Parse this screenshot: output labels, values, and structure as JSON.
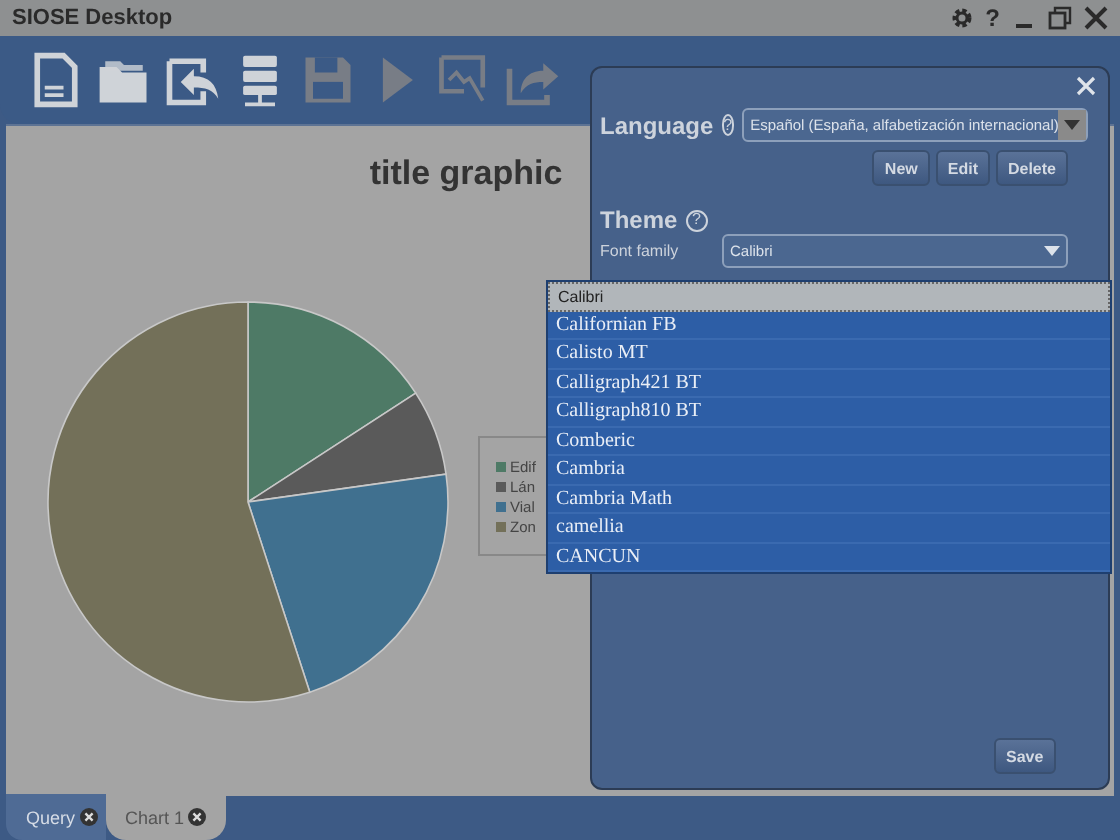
{
  "window": {
    "title": "SIOSE Desktop",
    "help": "?"
  },
  "toolbar": [
    {
      "kind": "new",
      "disabled": false
    },
    {
      "kind": "open",
      "disabled": false
    },
    {
      "kind": "import",
      "disabled": false
    },
    {
      "kind": "server",
      "disabled": false
    },
    {
      "kind": "save",
      "disabled": true
    },
    {
      "kind": "run",
      "disabled": true
    },
    {
      "kind": "chart",
      "disabled": true
    },
    {
      "kind": "export",
      "disabled": true
    }
  ],
  "chart": {
    "title": "title graphic",
    "legend": [
      {
        "label": "Edif",
        "color": "#4e7a66"
      },
      {
        "label": "Lán",
        "color": "#5a5a5a"
      },
      {
        "label": "Vial",
        "color": "#40708f"
      },
      {
        "label": "Zon",
        "color": "#737059"
      }
    ]
  },
  "settings": {
    "language_label": "Language",
    "help": "?",
    "language": "Español (España, alfabetización internacional)",
    "buttons": [
      "New",
      "Edit",
      "Delete"
    ],
    "theme_label": "Theme",
    "theme_help": "?",
    "font_family_label": "Font family",
    "font_family": "Calibri",
    "save": "Save"
  },
  "font_list": [
    {
      "label": "Calibri",
      "selected": true
    },
    {
      "label": "Californian FB",
      "selected": false
    },
    {
      "label": "Calisto MT",
      "selected": false
    },
    {
      "label": "Calligraph421 BT",
      "selected": false
    },
    {
      "label": "Calligraph810 BT",
      "selected": false
    },
    {
      "label": "Comberic",
      "selected": false
    },
    {
      "label": "Cambria",
      "selected": false
    },
    {
      "label": "Cambria Math",
      "selected": false
    },
    {
      "label": "camellia",
      "selected": false
    },
    {
      "label": "CANCUN",
      "selected": false
    }
  ],
  "tabs": [
    {
      "label": "Query",
      "selected": false
    },
    {
      "label": "Chart 1",
      "selected": true
    }
  ]
}
